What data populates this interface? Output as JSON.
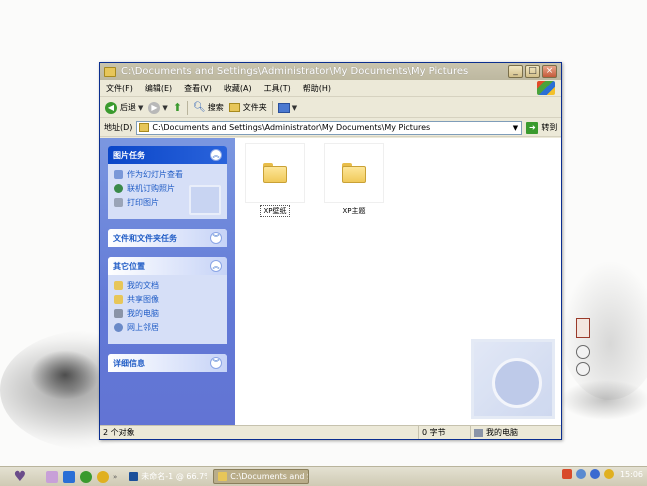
{
  "window": {
    "title": "C:\\Documents and Settings\\Administrator\\My Documents\\My Pictures"
  },
  "menu": [
    "文件(F)",
    "编辑(E)",
    "查看(V)",
    "收藏(A)",
    "工具(T)",
    "帮助(H)"
  ],
  "toolbar": {
    "back": "后退",
    "search": "搜索",
    "folders": "文件夹"
  },
  "address": {
    "label": "地址(D)",
    "value": "C:\\Documents and Settings\\Administrator\\My Documents\\My Pictures",
    "go": "转到"
  },
  "taskpane": {
    "picture_tasks": {
      "title": "图片任务",
      "links": [
        "作为幻灯片查看",
        "联机订购照片",
        "打印图片"
      ]
    },
    "file_tasks": {
      "title": "文件和文件夹任务"
    },
    "other_places": {
      "title": "其它位置",
      "links": [
        "我的文档",
        "共享图像",
        "我的电脑",
        "网上邻居"
      ]
    },
    "details": {
      "title": "详细信息"
    }
  },
  "files": [
    {
      "name": "XP壁纸"
    },
    {
      "name": "XP主题"
    }
  ],
  "status": {
    "objects": "2 个对象",
    "size": "0 字节",
    "location": "我的电脑"
  },
  "taskbar": {
    "task1": "未命名-1 @ 66.7%...",
    "task2": "C:\\Documents and S...",
    "clock": "15:06"
  },
  "colors": {
    "taskpane_blue": "#6279d6",
    "link_blue": "#215dc6",
    "go_green": "#3a9a2e"
  }
}
